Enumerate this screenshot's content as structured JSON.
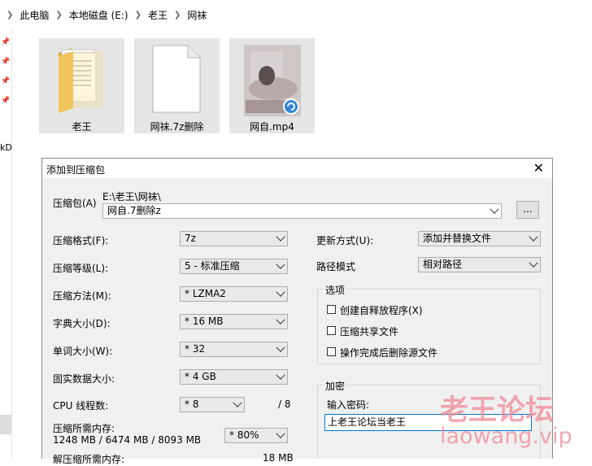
{
  "address": {
    "crumbs": [
      "此电脑",
      "本地磁盘 (E:)",
      "老王",
      "网袜"
    ]
  },
  "nav": {
    "partial_text": "kD"
  },
  "files": [
    {
      "name": "老王",
      "icon": "folder-icon"
    },
    {
      "name": "网袜.7z删除",
      "icon": "file-icon"
    },
    {
      "name": "网自.mp4",
      "icon": "video-icon"
    }
  ],
  "dialog": {
    "title": "添加到压缩包",
    "close": "✕",
    "archive_label": "压缩包(A)",
    "archive_path": "E:\\老王\\网袜\\",
    "archive_name": "网自.7删除z",
    "browse": "...",
    "format_label": "压缩格式(F):",
    "format_value": "7z",
    "level_label": "压缩等级(L):",
    "level_value": "5 - 标准压缩",
    "method_label": "压缩方法(M):",
    "method_value": "* LZMA2",
    "dict_label": "字典大小(D):",
    "dict_value": "* 16 MB",
    "word_label": "单词大小(W):",
    "word_value": "* 32",
    "solid_label": "固实数据大小:",
    "solid_value": "* 4 GB",
    "cpu_label": "CPU 线程数:",
    "cpu_value": "* 8",
    "cpu_total": "/ 8",
    "mem_label": "压缩所需内存:",
    "mem_value": "1248 MB / 6474 MB / 8093 MB",
    "mem_percent": "* 80%",
    "decomp_label": "解压缩所需内存:",
    "decomp_value": "18 MB",
    "update_label": "更新方式(U):",
    "update_value": "添加并替换文件",
    "path_label": "路径模式",
    "path_value": "相对路径",
    "options_label": "选项",
    "opt1": "创建自释放程序(X)",
    "opt2": "压缩共享文件",
    "opt3": "操作完成后删除源文件",
    "encrypt_label": "加密",
    "password_label": "输入密码:",
    "password_value": "上老王论坛当老王"
  },
  "watermark": {
    "line1": "老王论坛",
    "line2": "laowang.vip"
  }
}
